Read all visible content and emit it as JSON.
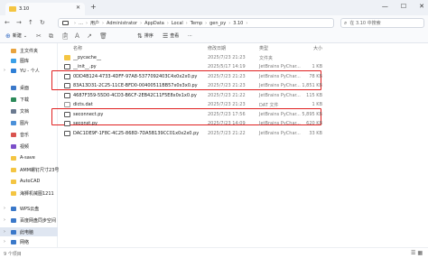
{
  "window": {
    "tab_title": "3.10",
    "tab_close": "✕",
    "new_tab": "+",
    "minimize": "—",
    "maximize": "☐",
    "close": "✕"
  },
  "nav": {
    "back": "←",
    "forward": "→",
    "up": "↑",
    "refresh": "↻"
  },
  "address": {
    "crumbs": [
      "用户",
      "Administrator",
      "AppData",
      "Local",
      "Temp",
      "gen_py",
      "3.10"
    ],
    "sep": "›",
    "more": "…"
  },
  "search": {
    "placeholder": "在 3.10 中搜索",
    "icon": "search-icon"
  },
  "toolbar": {
    "new": "新建",
    "new_arrow": "⌄",
    "sort": "排序",
    "view": "查看",
    "more": "···"
  },
  "sidebar": {
    "items": [
      {
        "label": "主文件夹",
        "icon": "home-icon",
        "color": "#e8a33d"
      },
      {
        "label": "图库",
        "icon": "gallery-icon",
        "color": "#3aa0e8"
      },
      {
        "label": "YU - 个人",
        "icon": "cloud-icon",
        "color": "#2f7fd6"
      },
      {
        "label": "桌面",
        "icon": "desktop-icon",
        "color": "#3a78c9"
      },
      {
        "label": "下载",
        "icon": "download-icon",
        "color": "#2c8a5a"
      },
      {
        "label": "文档",
        "icon": "document-icon",
        "color": "#6b7a90"
      },
      {
        "label": "图片",
        "icon": "pictures-icon",
        "color": "#4a90d9"
      },
      {
        "label": "音乐",
        "icon": "music-icon",
        "color": "#d9534f"
      },
      {
        "label": "视频",
        "icon": "video-icon",
        "color": "#7b4fc9"
      },
      {
        "label": "A-save",
        "icon": "folder-icon",
        "color": "#f4c542"
      },
      {
        "label": "AMM螺钉尺寸23号",
        "icon": "folder-icon",
        "color": "#f4c542"
      },
      {
        "label": "AutoCAD",
        "icon": "folder-icon",
        "color": "#f4c542"
      },
      {
        "label": "海狮机械图1211",
        "icon": "folder-icon",
        "color": "#f4c542"
      },
      {
        "label": "WPS云盘",
        "icon": "cloud-icon",
        "color": "#3a78c9"
      },
      {
        "label": "百度网盘同步空间",
        "icon": "cloud-icon",
        "color": "#3a78c9"
      },
      {
        "label": "此电脑",
        "icon": "computer-icon",
        "color": "#3a78c9"
      },
      {
        "label": "网络",
        "icon": "network-icon",
        "color": "#3a78c9"
      }
    ],
    "selected_index": 15,
    "expand": "›"
  },
  "columns": {
    "name": "名称",
    "date": "修改日期",
    "type": "类型",
    "size": "大小"
  },
  "files": [
    {
      "name": "__pycache__",
      "date": "2025/7/23 21:23",
      "type": "文件夹",
      "size": "",
      "kind": "folder"
    },
    {
      "name": "__init__.py",
      "date": "2025/5/17 14:19",
      "type": "JetBrains PyChar...",
      "size": "1 KB",
      "kind": "py"
    },
    {
      "name": "0DD4B124-4733-4DFF-97A8-5377092403C4x0x2x0.py",
      "date": "2025/7/23 21:23",
      "type": "JetBrains PyChar...",
      "size": "78 KB",
      "kind": "py"
    },
    {
      "name": "83A13D31-2C25-11CE-BFD0-00400511BB57x0x3x0.py",
      "date": "2025/7/23 21:23",
      "type": "JetBrains PyChar...",
      "size": "1,851 KB",
      "kind": "py"
    },
    {
      "name": "4687F359-55D0-4CD3-B6CF-2EB42C11F5E8x0x1x0.py",
      "date": "2025/7/23 21:22",
      "type": "JetBrains PyChar...",
      "size": "115 KB",
      "kind": "py"
    },
    {
      "name": "dicts.dat",
      "date": "2025/7/23 21:23",
      "type": "DAT 文件",
      "size": "1 KB",
      "kind": "dat"
    },
    {
      "name": "seconnect.py",
      "date": "2025/7/23 17:56",
      "type": "JetBrains PyChar...",
      "size": "5,895 KB",
      "kind": "py"
    },
    {
      "name": "seconst.py",
      "date": "2025/7/23 14:09",
      "type": "JetBrains PyChar...",
      "size": "620 KB",
      "kind": "py"
    },
    {
      "name": "DAC1DE9F-1F8C-4C25-868D-7DA5B139CC01x0x2x0.py",
      "date": "2025/7/23 21:22",
      "type": "JetBrains PyChar...",
      "size": "33 KB",
      "kind": "py"
    }
  ],
  "status": {
    "count": "9 个项目",
    "view_details": "☰",
    "view_tiles": "▦"
  }
}
